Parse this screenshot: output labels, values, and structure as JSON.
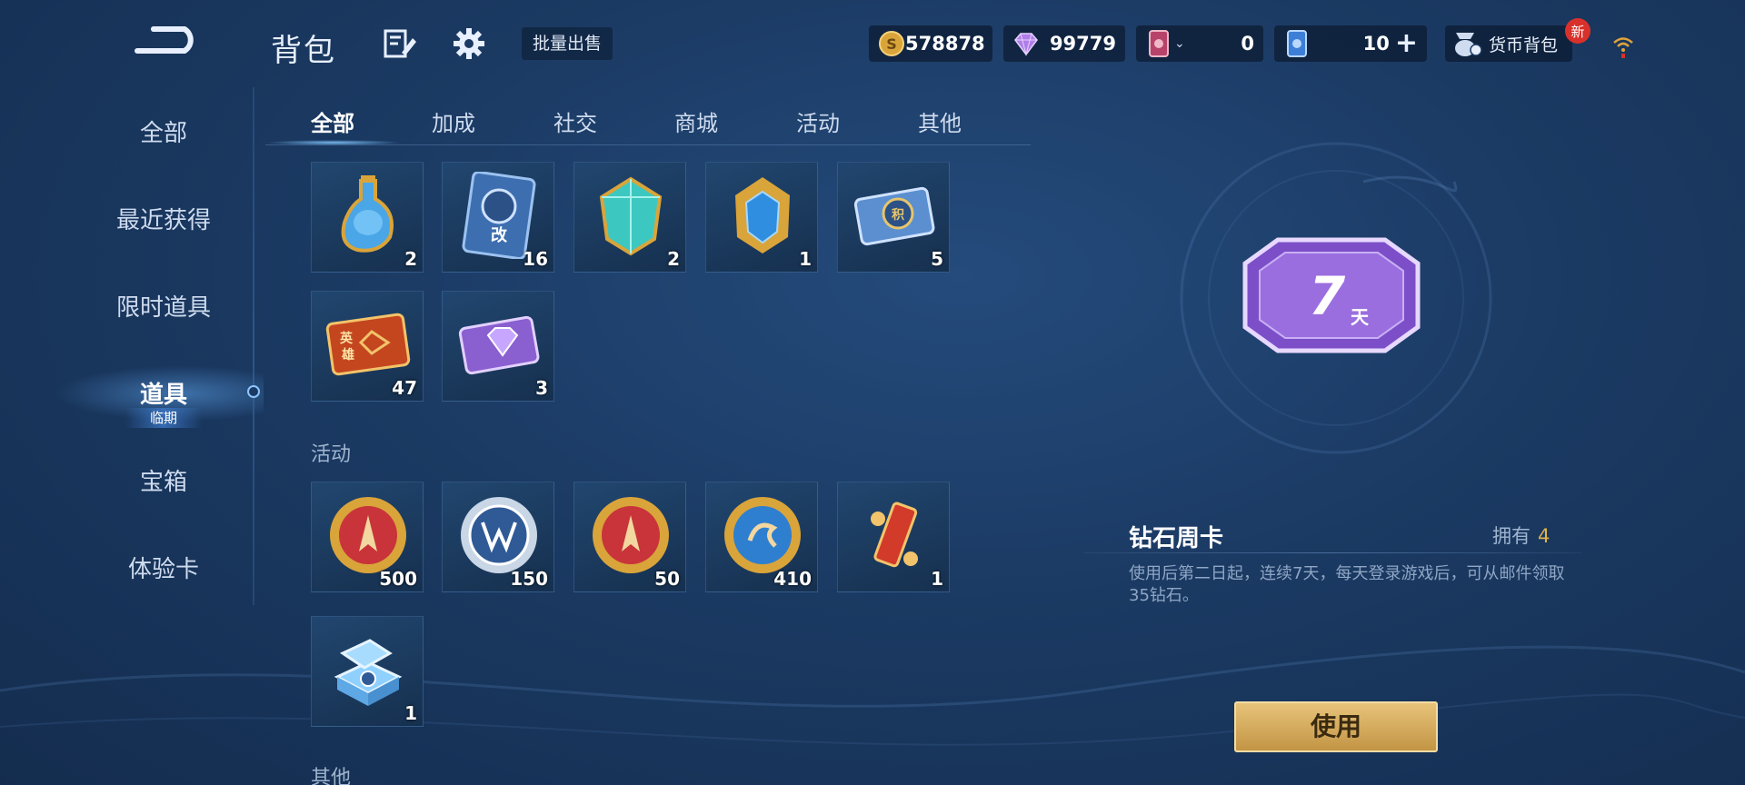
{
  "header": {
    "title": "背包",
    "bulk_sell_label": "批量出售",
    "currencies": {
      "gold": "578878",
      "diamond": "99779",
      "card": "0",
      "coupon": "10"
    },
    "currency_bag_label": "货币背包",
    "new_badge": "新"
  },
  "sidebar": {
    "items": [
      {
        "label": "全部"
      },
      {
        "label": "最近获得"
      },
      {
        "label": "限时道具",
        "tag": "临期"
      },
      {
        "label": "道具"
      },
      {
        "label": "宝箱"
      },
      {
        "label": "体验卡"
      }
    ],
    "active": "道具"
  },
  "tabs": {
    "items": [
      {
        "label": "全部"
      },
      {
        "label": "加成"
      },
      {
        "label": "社交"
      },
      {
        "label": "商城"
      },
      {
        "label": "活动"
      },
      {
        "label": "其他"
      }
    ],
    "active": "全部"
  },
  "grid": {
    "row1": [
      {
        "icon": "potion-icon",
        "count": "2"
      },
      {
        "icon": "rename-card-icon",
        "count": "16"
      },
      {
        "icon": "crystal-gem-icon",
        "count": "2"
      },
      {
        "icon": "blue-gem-icon",
        "count": "1"
      },
      {
        "icon": "point-ticket-icon",
        "count": "5"
      }
    ],
    "row2": [
      {
        "icon": "hero-ticket-icon",
        "count": "47"
      },
      {
        "icon": "diamond-card-icon",
        "count": "3"
      }
    ],
    "section_activity": "活动",
    "row3": [
      {
        "icon": "red-pen-coin-icon",
        "count": "500"
      },
      {
        "icon": "vw-coin-icon",
        "count": "150"
      },
      {
        "icon": "red-pen-coin-icon",
        "count": "50"
      },
      {
        "icon": "blue-gold-coin-icon",
        "count": "410"
      },
      {
        "icon": "scroll-icon",
        "count": "1"
      }
    ],
    "row4": [
      {
        "icon": "gift-box-icon",
        "count": "1"
      }
    ],
    "section_other": "其他"
  },
  "detail": {
    "emblem_text_num": "7",
    "emblem_text_unit": "天",
    "name": "钻石周卡",
    "own_label": "拥有",
    "own_count": "4",
    "description": "使用后第二日起，连续7天，每天登录游戏后，可从邮件领取35钻石。",
    "use_label": "使用"
  },
  "colors": {
    "background": "#1b3a63",
    "gold_button": "#d4aa5c",
    "own_count": "#e0b24a",
    "badge_red": "#d8312b"
  }
}
